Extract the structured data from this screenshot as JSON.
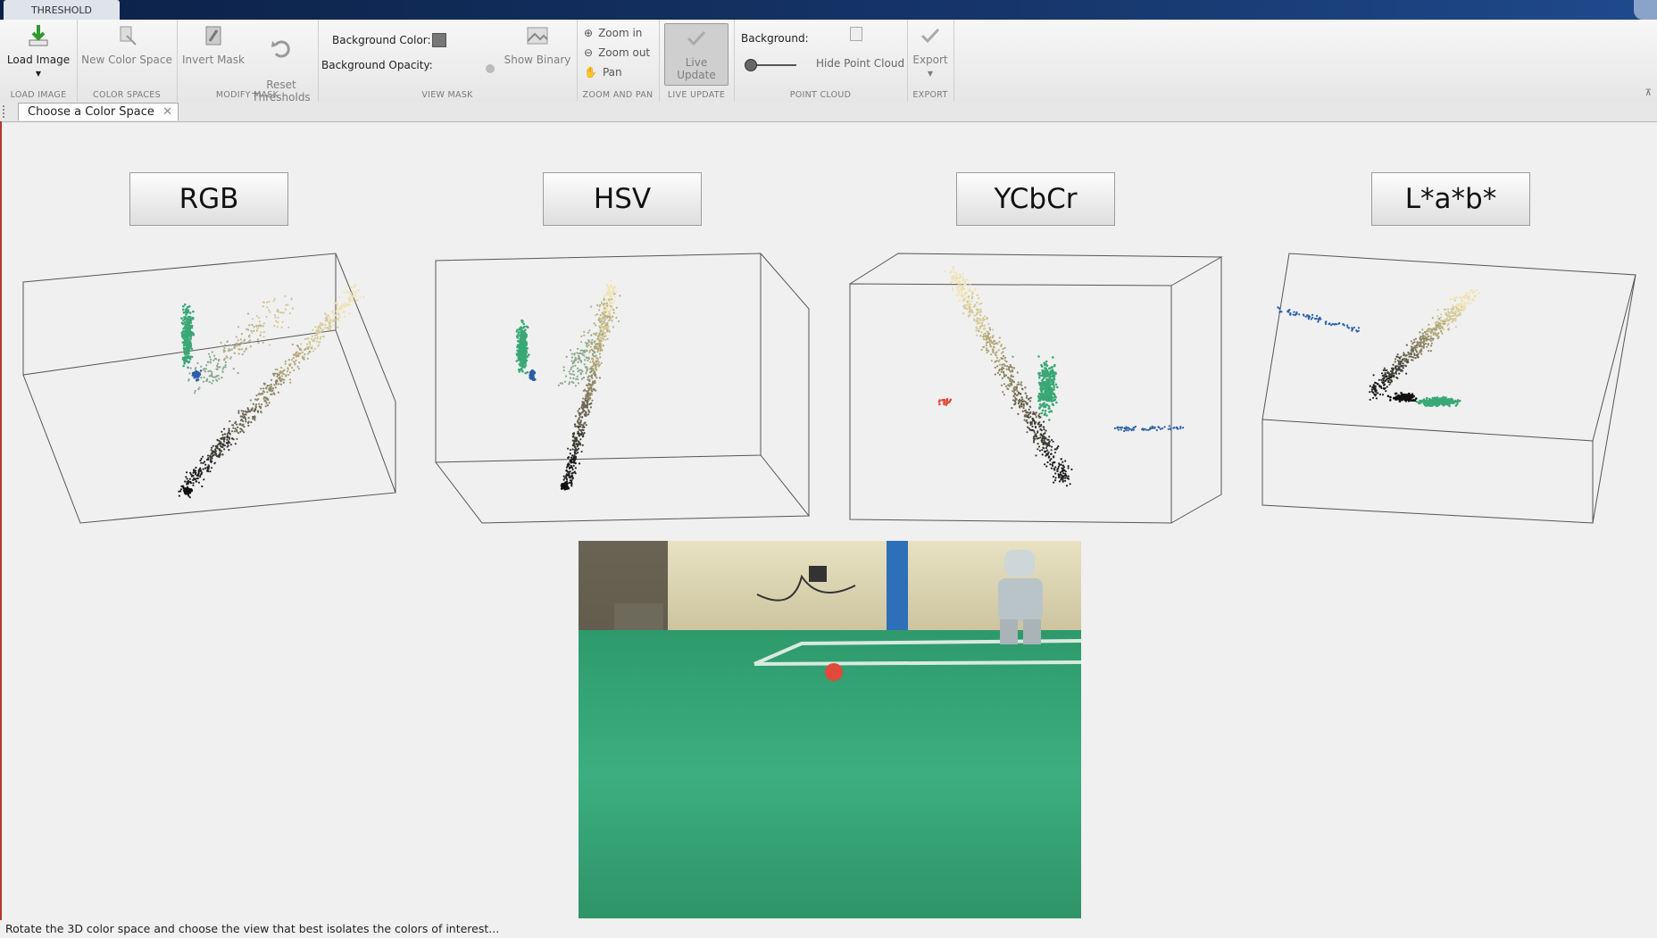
{
  "app": {
    "tab_title": "THRESHOLD"
  },
  "toolstrip": {
    "load_image": {
      "label": "Load Image",
      "section": "LOAD IMAGE",
      "icon": "download-arrow-icon"
    },
    "color_spaces": {
      "new_color_space": "New Color Space",
      "section": "COLOR SPACES",
      "icon": "new-color-space-icon"
    },
    "modify_mask": {
      "invert_mask": "Invert Mask",
      "reset_thresholds": "Reset\nThresholds",
      "section": "MODIFY MASK"
    },
    "view_mask": {
      "background_color": "Background Color:",
      "background_opacity": "Background Opacity:",
      "show_binary": "Show Binary",
      "section": "VIEW MASK"
    },
    "zoom_pan": {
      "zoom_in": "Zoom in",
      "zoom_out": "Zoom out",
      "pan": "Pan",
      "section": "ZOOM AND PAN"
    },
    "live_update": {
      "label": "Live Update",
      "section": "LIVE UPDATE"
    },
    "point_cloud": {
      "background": "Background:",
      "hide_point_cloud": "Hide Point Cloud",
      "section": "POINT CLOUD"
    },
    "export": {
      "label": "Export",
      "section": "EXPORT"
    }
  },
  "document_tab": {
    "label": "Choose a Color Space"
  },
  "color_space_buttons": [
    "RGB",
    "HSV",
    "YCbCr",
    "L*a*b*"
  ],
  "colors": {
    "title_bar": "#0b2146",
    "field_green": "#3aa876",
    "wall_beige": "#d9d2b0",
    "ball_red": "#e04a3a"
  },
  "status": {
    "text": "Rotate the 3D color space and choose the view that best isolates the colors of interest..."
  }
}
